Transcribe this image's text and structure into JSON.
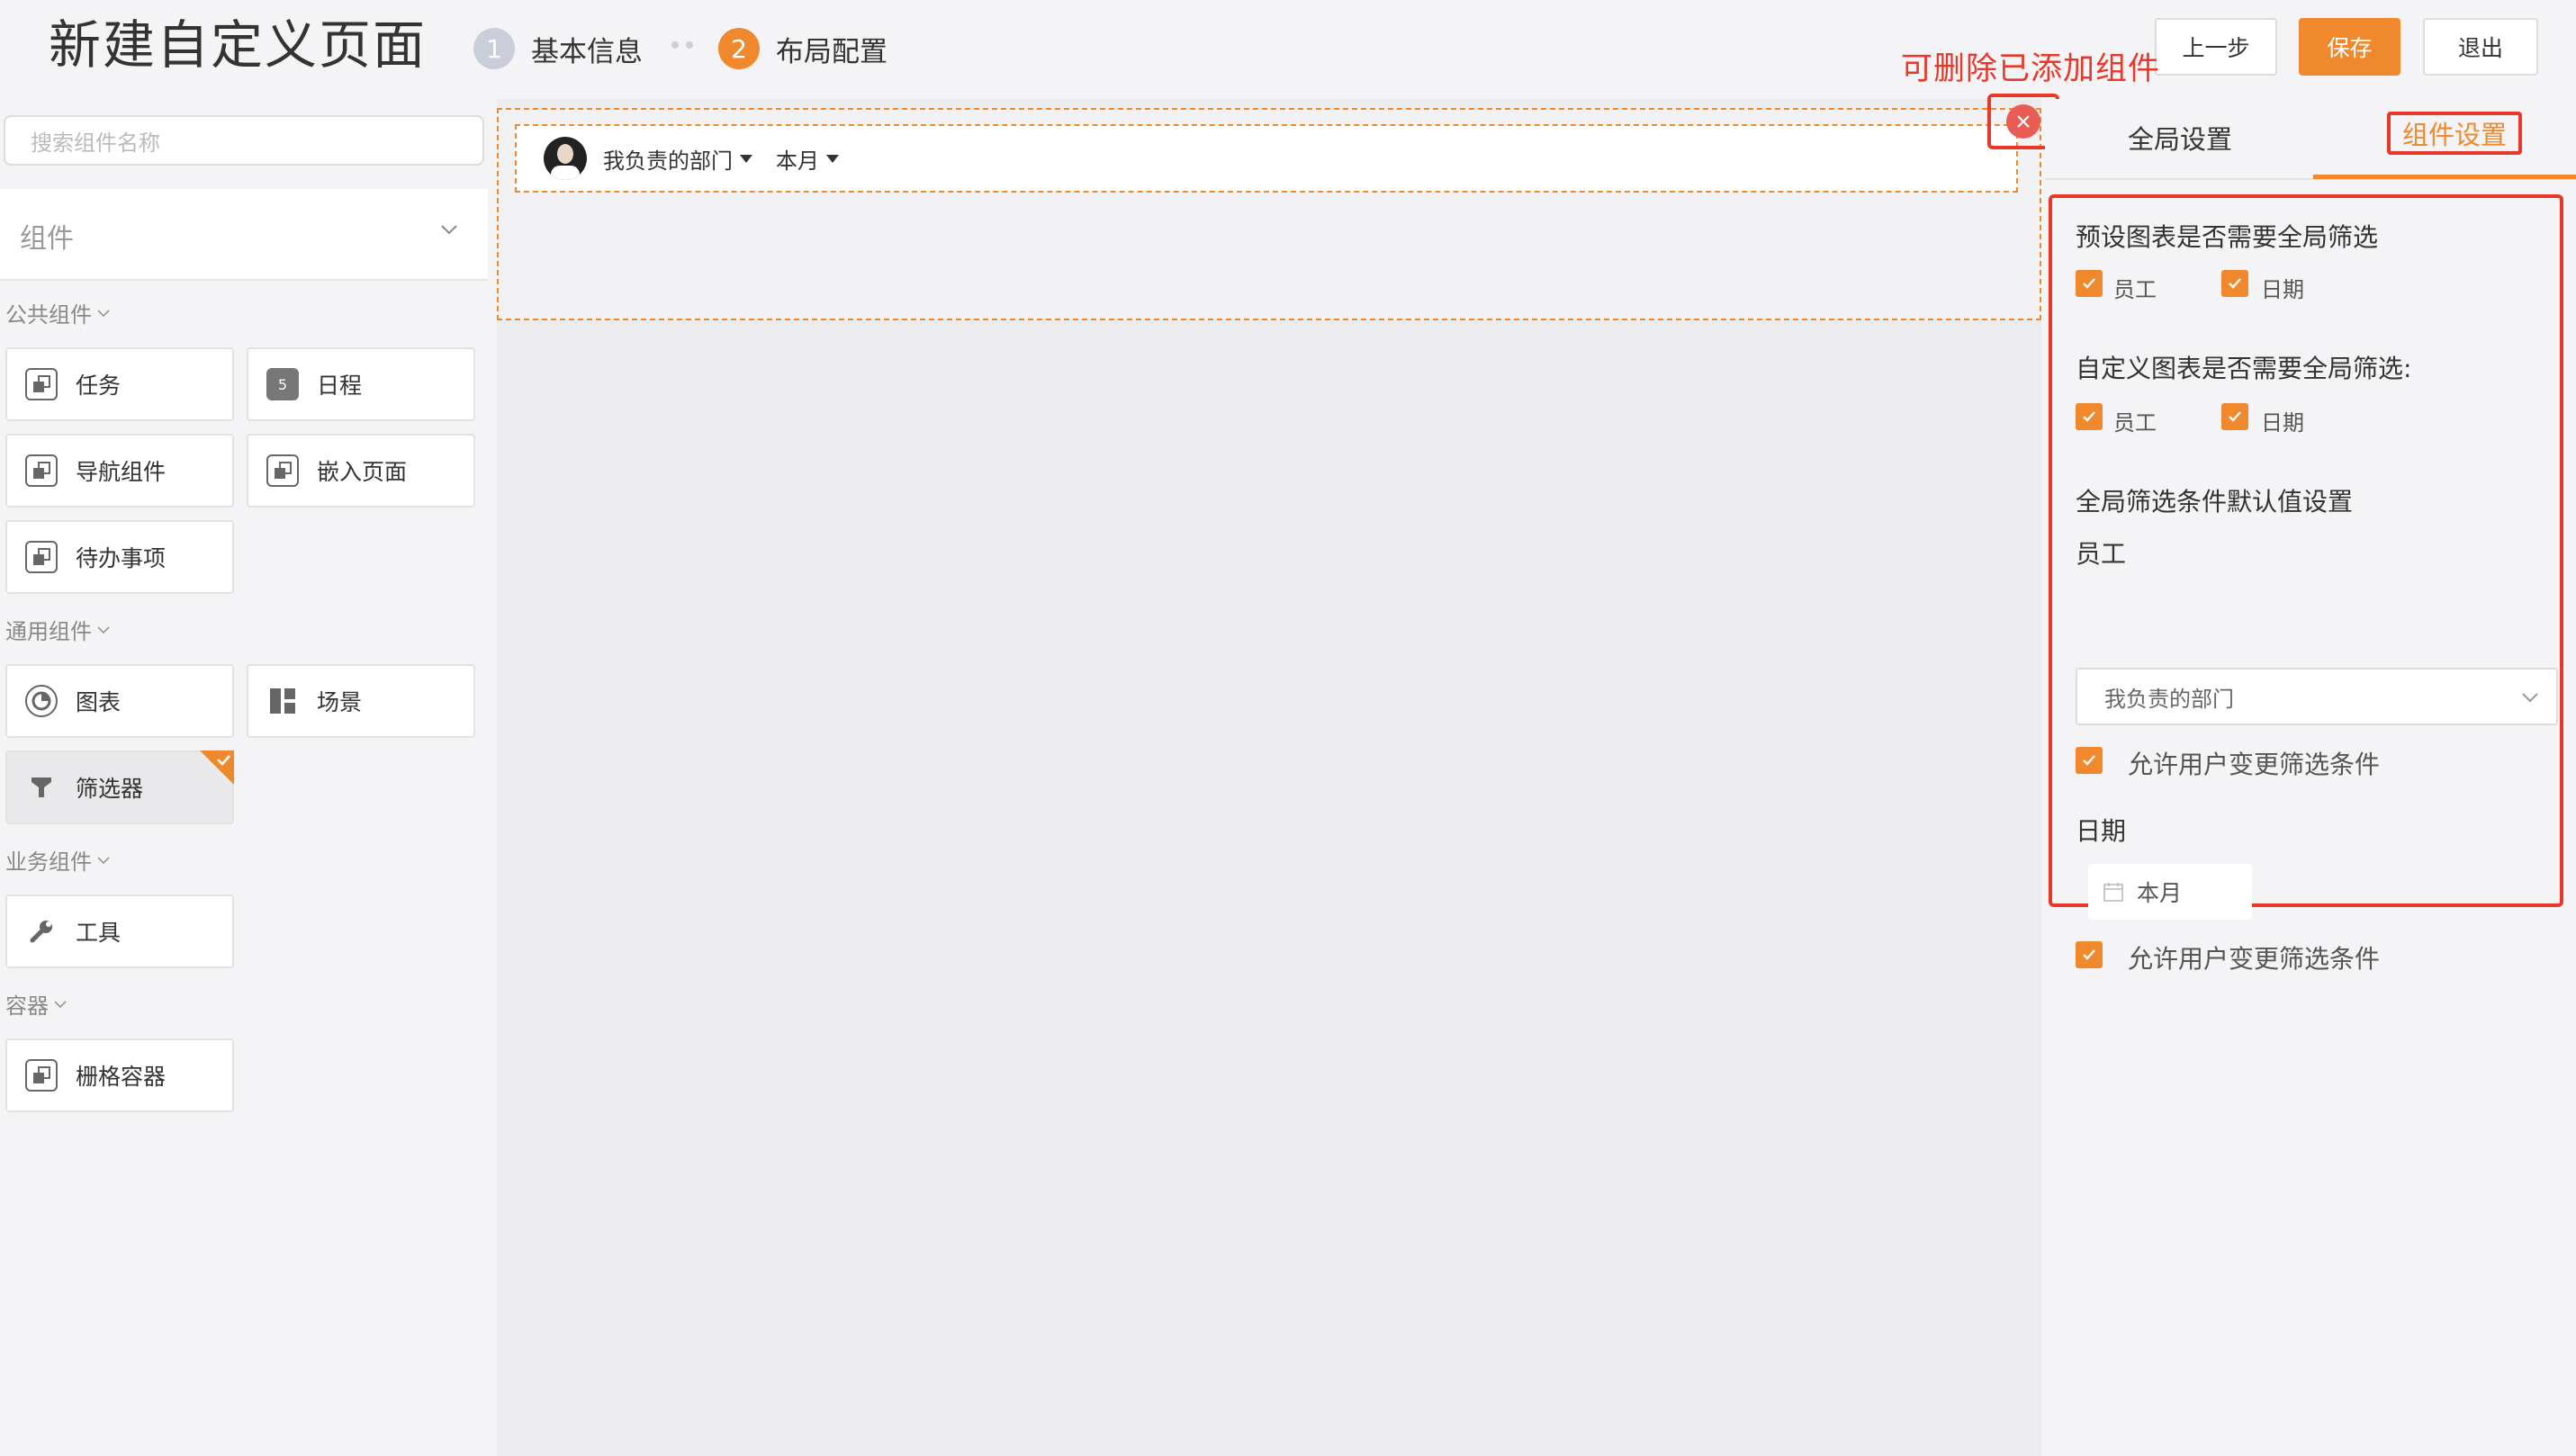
{
  "header": {
    "title": "新建自定义页面",
    "steps": [
      {
        "num": "1",
        "label": "基本信息"
      },
      {
        "num": "2",
        "label": "布局配置"
      }
    ],
    "buttons": {
      "prev": "上一步",
      "save": "保存",
      "exit": "退出"
    },
    "annotation": "可删除已添加组件"
  },
  "left": {
    "search_placeholder": "搜索组件名称",
    "components_title": "组件",
    "sections": {
      "public": "公共组件",
      "general": "通用组件",
      "business": "业务组件",
      "container": "容器"
    },
    "tiles": {
      "task": "任务",
      "schedule": "日程",
      "nav": "导航组件",
      "embed": "嵌入页面",
      "todo": "待办事项",
      "chart": "图表",
      "scene": "场景",
      "filter": "筛选器",
      "tool": "工具",
      "grid": "栅格容器"
    },
    "schedule_icon_text": "5"
  },
  "canvas": {
    "filter_dept": "我负责的部门",
    "filter_month": "本月"
  },
  "right": {
    "tabs": {
      "global": "全局设置",
      "component": "组件设置"
    },
    "preset_q": "预设图表是否需要全局筛选",
    "custom_q": "自定义图表是否需要全局筛选:",
    "opt_employee": "员工",
    "opt_date": "日期",
    "default_title": "全局筛选条件默认值设置",
    "employee_label": "员工",
    "employee_select": "我负责的部门",
    "allow_change": "允许用户变更筛选条件",
    "date_label": "日期",
    "date_value": "本月"
  },
  "colors": {
    "accent": "#f0892d",
    "annotation": "#e8382a",
    "close": "#ea5d55"
  }
}
